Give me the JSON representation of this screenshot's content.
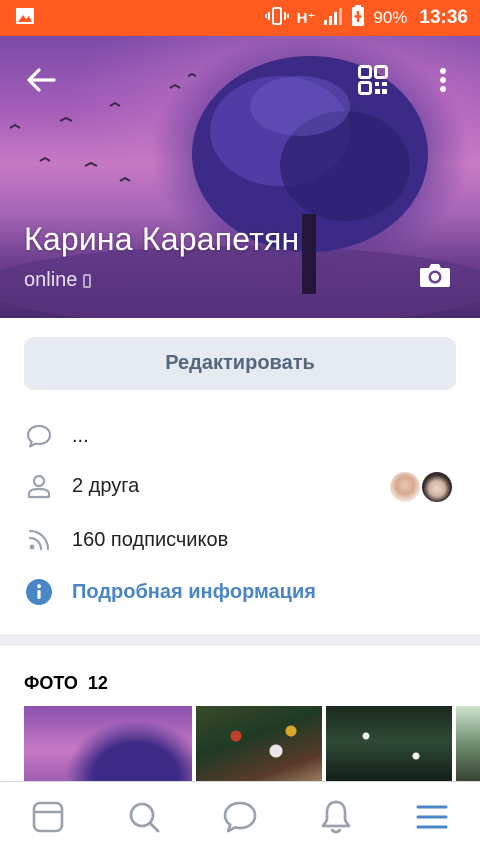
{
  "status_bar": {
    "network": "H⁺",
    "battery": "90%",
    "time": "13:36"
  },
  "profile": {
    "name": "Карина Карапетян",
    "status": "online"
  },
  "actions": {
    "edit_label": "Редактировать"
  },
  "info": {
    "status_text": "...",
    "friends": "2 друга",
    "followers": "160 подписчиков",
    "details_link": "Подробная информация"
  },
  "photos": {
    "label": "ФОТО",
    "count": "12"
  },
  "colors": {
    "status_bar": "#ff5a1f",
    "accent": "#4a86c5",
    "edit_button_bg": "#e5ebf1",
    "edit_button_text": "#55677d",
    "icon_gray": "#99a2ad"
  },
  "icons": {
    "back": "arrow-left-icon",
    "qr": "qr-code-icon",
    "more": "more-vertical-icon",
    "camera": "camera-icon",
    "status": "speech-bubble-icon",
    "friends": "user-icon",
    "followers": "rss-icon",
    "details": "info-icon",
    "nav": [
      "news-feed-icon",
      "search-icon",
      "messages-icon",
      "notifications-icon",
      "menu-icon"
    ]
  }
}
